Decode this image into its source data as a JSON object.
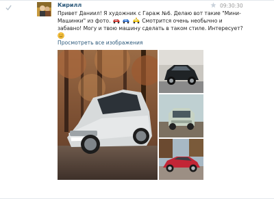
{
  "message": {
    "author": "Кирилл",
    "time": "09:30:30",
    "text_line1": "Привет Даниил! Я художник с Гараж №6. Делаю вот такие \"Мини-",
    "text_line2_a": "Машинки\" из фото.",
    "text_line2_b": "Смотрится очень необычно и",
    "text_line3": "забавно! Могу и твою машину сделать в таком стиле. Интересует?",
    "view_all_link": "Просмотреть все изображения"
  },
  "icons": {
    "read_status": "check-icon",
    "favorite": "star-icon",
    "emojis": [
      "red-car-emoji",
      "blue-car-emoji",
      "taxi-emoji",
      "smiling-face-emoji"
    ]
  },
  "photos": [
    {
      "name": "photo-white-hatchback",
      "subject": "white hatchback in autumn forest"
    },
    {
      "name": "photo-black-mini-car",
      "subject": "black compact car"
    },
    {
      "name": "photo-green-mini-car",
      "subject": "green compact car"
    },
    {
      "name": "photo-red-mini-car",
      "subject": "red compact car"
    }
  ],
  "colors": {
    "link": "#2b587a",
    "time": "#999999"
  }
}
